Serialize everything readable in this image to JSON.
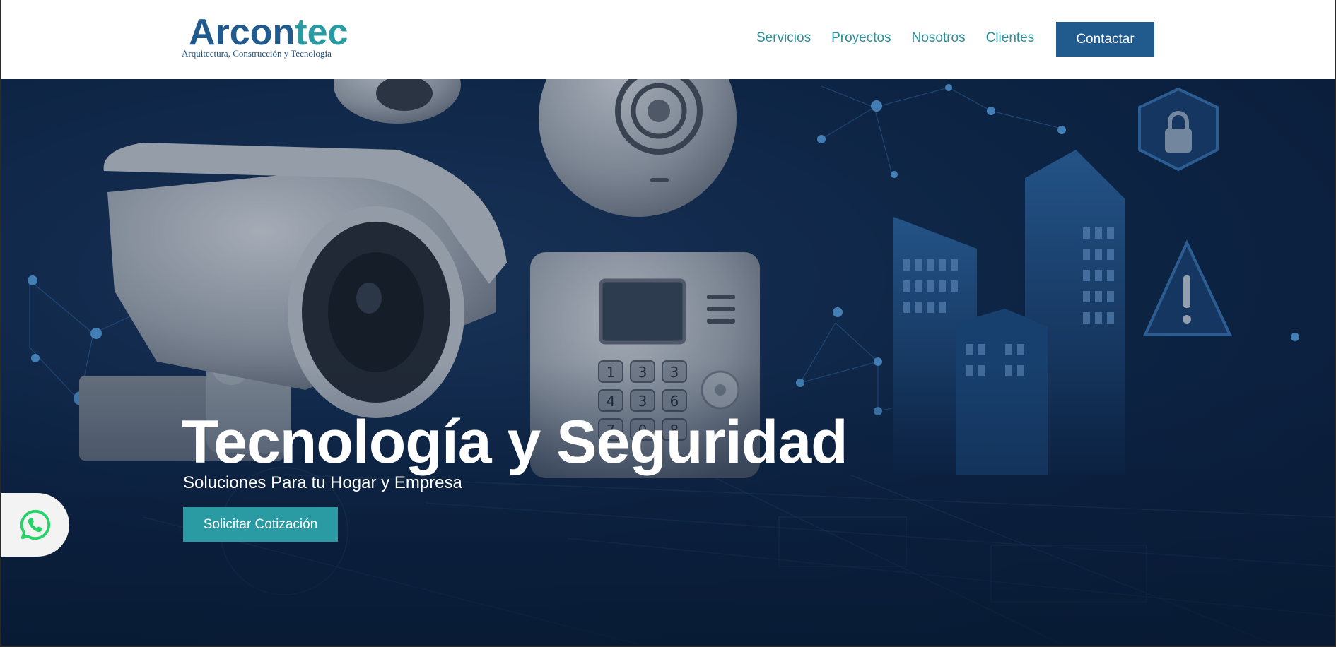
{
  "brand": {
    "name_part1": "Arcon",
    "name_part2": "tec",
    "tagline": "Arquitectura, Construcción y Tecnología",
    "color_primary": "#215a8c",
    "color_accent": "#2a9aa3"
  },
  "nav": {
    "links": [
      {
        "label": "Servicios"
      },
      {
        "label": "Proyectos"
      },
      {
        "label": "Nosotros"
      },
      {
        "label": "Clientes"
      }
    ],
    "contact_label": "Contactar"
  },
  "hero": {
    "title": "Tecnología y Seguridad",
    "subtitle": "Soluciones Para tu Hogar y Empresa",
    "cta_label": "Solicitar Cotización",
    "keypad_keys": [
      "1",
      "3",
      "3",
      "4",
      "3",
      "6",
      "7",
      "0",
      "8"
    ]
  },
  "floating": {
    "whatsapp_icon": "whatsapp-icon",
    "whatsapp_color": "#25d366"
  }
}
